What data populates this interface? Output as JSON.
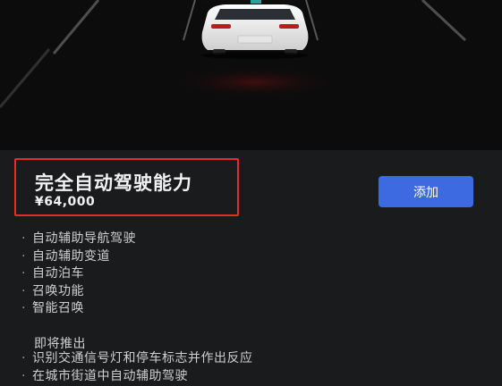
{
  "hero": {
    "car_icon": "car-rear-icon",
    "colors": {
      "background": "#0c0c0d",
      "road_glow": "#9a9a9a",
      "car": "#f4f4f4",
      "taillight": "#b81d1d"
    }
  },
  "product": {
    "title": "完全自动驾驶能力",
    "price": "¥64,000",
    "add_label": "添加",
    "highlight_color": "#e0302c",
    "button_color": "#3e6ae1"
  },
  "features": [
    {
      "bullet": "·",
      "label": "自动辅助导航驾驶"
    },
    {
      "bullet": "·",
      "label": "自动辅助变道"
    },
    {
      "bullet": "·",
      "label": "自动泊车"
    },
    {
      "bullet": "·",
      "label": "召唤功能"
    },
    {
      "bullet": "·",
      "label": "智能召唤"
    }
  ],
  "upcoming": {
    "heading": "即将推出",
    "items": [
      {
        "bullet": "·",
        "label": "识别交通信号灯和停车标志并作出反应"
      },
      {
        "bullet": "·",
        "label": "在城市街道中自动辅助驾驶"
      }
    ]
  }
}
